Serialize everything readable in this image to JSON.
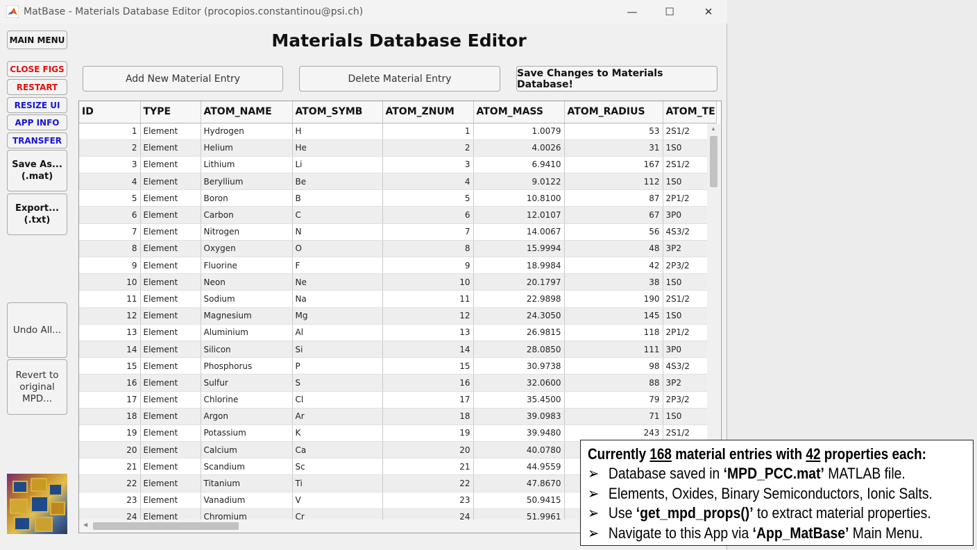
{
  "window": {
    "title": "MatBase - Materials Database Editor (procopios.constantinou@psi.ch)",
    "minimize_glyph": "—",
    "maximize_glyph": "☐",
    "close_glyph": "✕"
  },
  "sidebar": {
    "main_menu": "MAIN MENU",
    "close_figs": "CLOSE FIGS",
    "restart": "RESTART",
    "resize_ui": "RESIZE UI",
    "app_info": "APP INFO",
    "transfer": "TRANSFER",
    "save_as_line1": "Save As...",
    "save_as_line2": "(.mat)",
    "export_line1": "Export...",
    "export_line2": "(.txt)",
    "undo_all": "Undo All...",
    "revert_line1": "Revert to",
    "revert_line2": "original",
    "revert_line3": "MPD..."
  },
  "main": {
    "title": "Materials Database Editor",
    "add_button": "Add New Material Entry",
    "delete_button": "Delete Material Entry",
    "save_button": "Save Changes to Materials Database!"
  },
  "table": {
    "columns": [
      "ID",
      "TYPE",
      "ATOM_NAME",
      "ATOM_SYMB",
      "ATOM_ZNUM",
      "ATOM_MASS",
      "ATOM_RADIUS",
      "ATOM_TE"
    ],
    "rows": [
      [
        "1",
        "Element",
        "Hydrogen",
        "H",
        "1",
        "1.0079",
        "53",
        "2S1/2"
      ],
      [
        "2",
        "Element",
        "Helium",
        "He",
        "2",
        "4.0026",
        "31",
        "1S0"
      ],
      [
        "3",
        "Element",
        "Lithium",
        "Li",
        "3",
        "6.9410",
        "167",
        "2S1/2"
      ],
      [
        "4",
        "Element",
        "Beryllium",
        "Be",
        "4",
        "9.0122",
        "112",
        "1S0"
      ],
      [
        "5",
        "Element",
        "Boron",
        "B",
        "5",
        "10.8100",
        "87",
        "2P1/2"
      ],
      [
        "6",
        "Element",
        "Carbon",
        "C",
        "6",
        "12.0107",
        "67",
        "3P0"
      ],
      [
        "7",
        "Element",
        "Nitrogen",
        "N",
        "7",
        "14.0067",
        "56",
        "4S3/2"
      ],
      [
        "8",
        "Element",
        "Oxygen",
        "O",
        "8",
        "15.9994",
        "48",
        "3P2"
      ],
      [
        "9",
        "Element",
        "Fluorine",
        "F",
        "9",
        "18.9984",
        "42",
        "2P3/2"
      ],
      [
        "10",
        "Element",
        "Neon",
        "Ne",
        "10",
        "20.1797",
        "38",
        "1S0"
      ],
      [
        "11",
        "Element",
        "Sodium",
        "Na",
        "11",
        "22.9898",
        "190",
        "2S1/2"
      ],
      [
        "12",
        "Element",
        "Magnesium",
        "Mg",
        "12",
        "24.3050",
        "145",
        "1S0"
      ],
      [
        "13",
        "Element",
        "Aluminium",
        "Al",
        "13",
        "26.9815",
        "118",
        "2P1/2"
      ],
      [
        "14",
        "Element",
        "Silicon",
        "Si",
        "14",
        "28.0850",
        "111",
        "3P0"
      ],
      [
        "15",
        "Element",
        "Phosphorus",
        "P",
        "15",
        "30.9738",
        "98",
        "4S3/2"
      ],
      [
        "16",
        "Element",
        "Sulfur",
        "S",
        "16",
        "32.0600",
        "88",
        "3P2"
      ],
      [
        "17",
        "Element",
        "Chlorine",
        "Cl",
        "17",
        "35.4500",
        "79",
        "2P3/2"
      ],
      [
        "18",
        "Element",
        "Argon",
        "Ar",
        "18",
        "39.0983",
        "71",
        "1S0"
      ],
      [
        "19",
        "Element",
        "Potassium",
        "K",
        "19",
        "39.9480",
        "243",
        "2S1/2"
      ],
      [
        "20",
        "Element",
        "Calcium",
        "Ca",
        "20",
        "40.0780",
        "",
        ""
      ],
      [
        "21",
        "Element",
        "Scandium",
        "Sc",
        "21",
        "44.9559",
        "",
        ""
      ],
      [
        "22",
        "Element",
        "Titanium",
        "Ti",
        "22",
        "47.8670",
        "",
        ""
      ],
      [
        "23",
        "Element",
        "Vanadium",
        "V",
        "23",
        "50.9415",
        "",
        ""
      ],
      [
        "24",
        "Element",
        "Chromium",
        "Cr",
        "24",
        "51.9961",
        "",
        ""
      ]
    ]
  },
  "info": {
    "head_pre": "Currently ",
    "count": "168",
    "head_mid": " material entries with ",
    "props": "42",
    "head_post": " properties each:",
    "arrow": "➢",
    "l1_pre": "Database saved in ",
    "l1_bold": "‘MPD_PCC.mat’",
    "l1_post": " MATLAB file.",
    "l2": "Elements, Oxides, Binary Semiconductors, Ionic Salts.",
    "l3_pre": "Use ",
    "l3_bold": "‘get_mpd_props()’",
    "l3_post": " to extract material properties.",
    "l4_pre": "Navigate to this App via ",
    "l4_bold": "‘App_MatBase’",
    "l4_post": " Main Menu."
  },
  "colors": {
    "red_label": "#e01010",
    "blue_label": "#1616d8"
  }
}
